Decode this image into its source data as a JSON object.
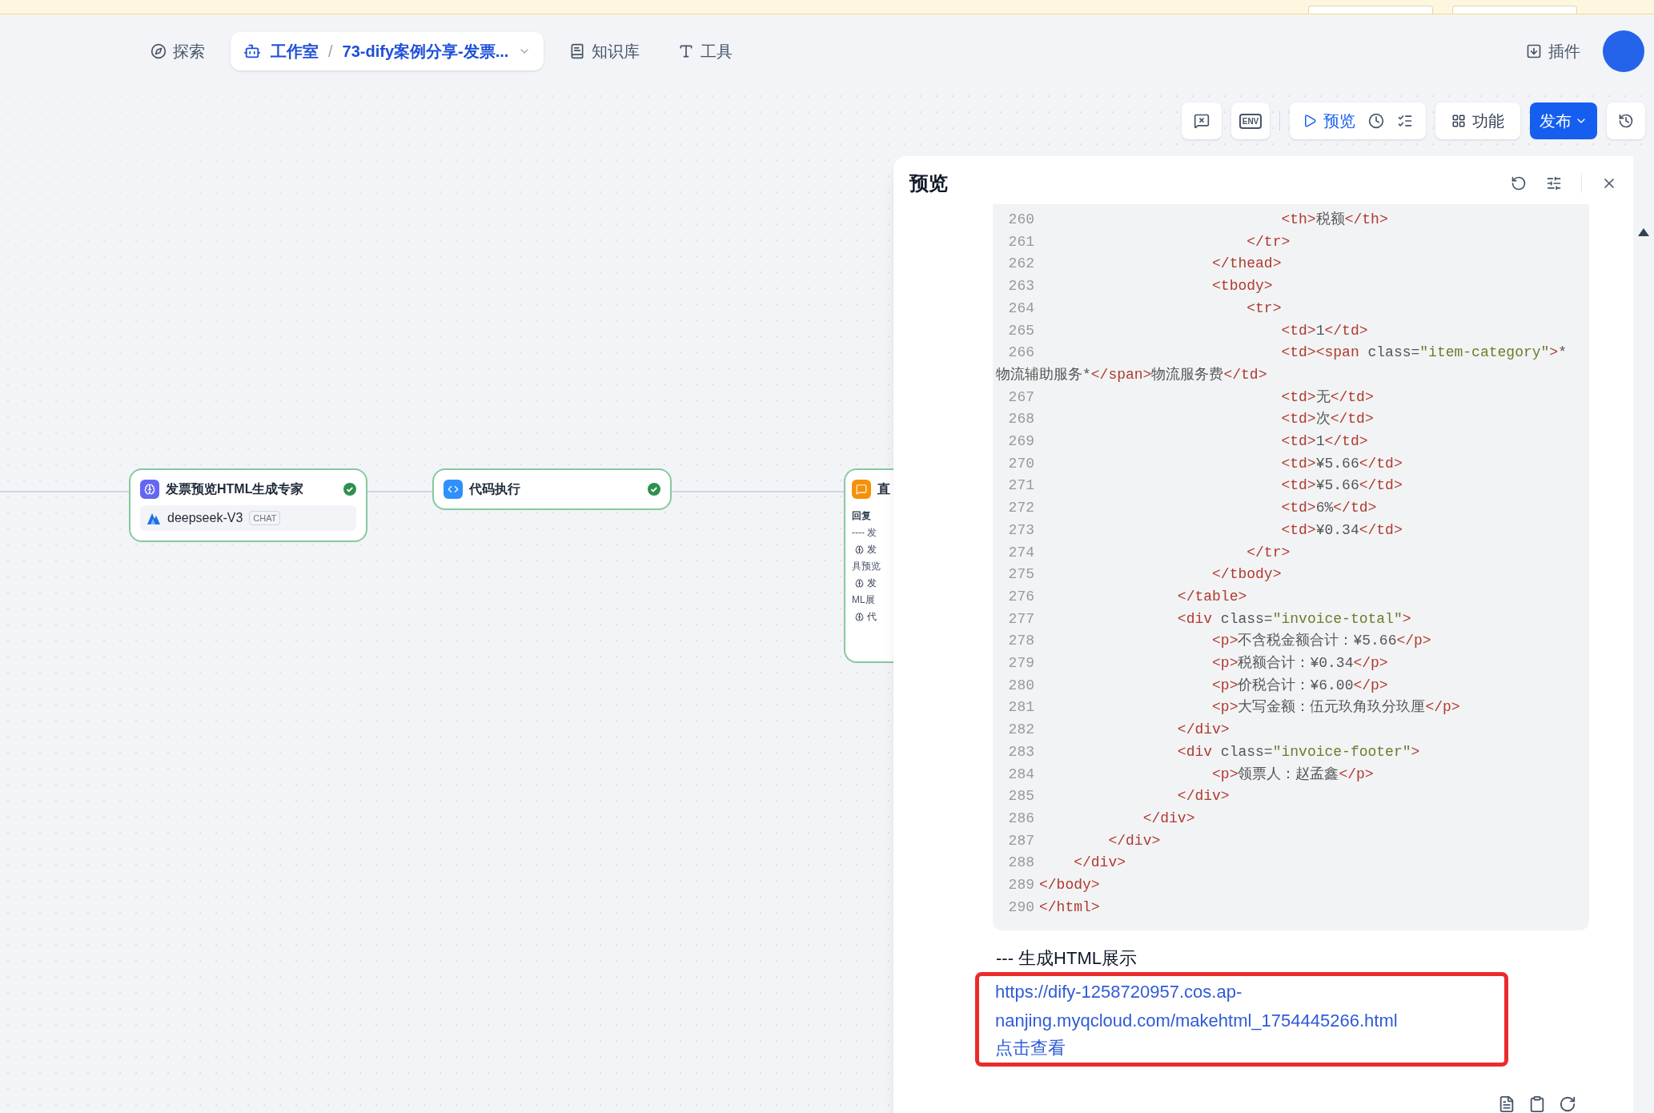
{
  "nav": {
    "explore": "探索",
    "studio": {
      "label": "工作室",
      "separator": "/",
      "app_name": "73-dify案例分享-发票..."
    },
    "knowledge": "知识库",
    "tools": "工具",
    "plugins": "插件"
  },
  "toolbar": {
    "env": "ENV",
    "preview": "预览",
    "features": "功能",
    "publish": "发布"
  },
  "canvas": {
    "nodes": [
      {
        "kind": "llm",
        "title": "发票预览HTML生成专家",
        "succeeded": true,
        "model": "deepseek-V3",
        "model_tag": "CHAT"
      },
      {
        "kind": "code",
        "title": "代码执行",
        "succeeded": true
      },
      {
        "kind": "answer",
        "title": "直",
        "body": [
          {
            "kind": "label",
            "text": "回复"
          },
          {
            "kind": "text",
            "text": "---- 发"
          },
          {
            "kind": "var",
            "text": "发"
          },
          {
            "kind": "text",
            "text": "具预览"
          },
          {
            "kind": "var",
            "text": "发"
          },
          {
            "kind": "text",
            "text": "ML展"
          },
          {
            "kind": "var",
            "text": "代"
          }
        ]
      }
    ]
  },
  "preview_panel": {
    "title": "预览",
    "code_lines": [
      {
        "number": "260",
        "text": "                            <th>税额</th>"
      },
      {
        "number": "261",
        "text": "                        </tr>"
      },
      {
        "number": "262",
        "text": "                    </thead>"
      },
      {
        "number": "263",
        "text": "                    <tbody>"
      },
      {
        "number": "264",
        "text": "                        <tr>"
      },
      {
        "number": "265",
        "text": "                            <td>1</td>"
      },
      {
        "number": "266",
        "text": "                            <td><span class=\"item-category\">*物流辅助服务*</span>物流服务费</td>"
      },
      {
        "number": "267",
        "text": "                            <td>无</td>"
      },
      {
        "number": "268",
        "text": "                            <td>次</td>"
      },
      {
        "number": "269",
        "text": "                            <td>1</td>"
      },
      {
        "number": "270",
        "text": "                            <td>¥5.66</td>"
      },
      {
        "number": "271",
        "text": "                            <td>¥5.66</td>"
      },
      {
        "number": "272",
        "text": "                            <td>6%</td>"
      },
      {
        "number": "273",
        "text": "                            <td>¥0.34</td>"
      },
      {
        "number": "274",
        "text": "                        </tr>"
      },
      {
        "number": "275",
        "text": "                    </tbody>"
      },
      {
        "number": "276",
        "text": "                </table>"
      },
      {
        "number": "277",
        "text": "                <div class=\"invoice-total\">"
      },
      {
        "number": "278",
        "text": "                    <p>不含税金额合计：¥5.66</p>"
      },
      {
        "number": "279",
        "text": "                    <p>税额合计：¥0.34</p>"
      },
      {
        "number": "280",
        "text": "                    <p>价税合计：¥6.00</p>"
      },
      {
        "number": "281",
        "text": "                    <p>大写金额：伍元玖角玖分玖厘</p>"
      },
      {
        "number": "282",
        "text": "                </div>"
      },
      {
        "number": "283",
        "text": "                <div class=\"invoice-footer\">"
      },
      {
        "number": "284",
        "text": "                    <p>领票人：赵孟鑫</p>"
      },
      {
        "number": "285",
        "text": "                </div>"
      },
      {
        "number": "286",
        "text": "            </div>"
      },
      {
        "number": "287",
        "text": "        </div>"
      },
      {
        "number": "288",
        "text": "    </div>"
      },
      {
        "number": "289",
        "text": "</body>"
      },
      {
        "number": "290",
        "text": "</html>"
      }
    ],
    "section_heading": "--- 生成HTML展示",
    "link": "https://dify-1258720957.cos.ap-nanjing.myqcloud.com/makehtml_1754445266.html",
    "view_link": "点击查看"
  }
}
